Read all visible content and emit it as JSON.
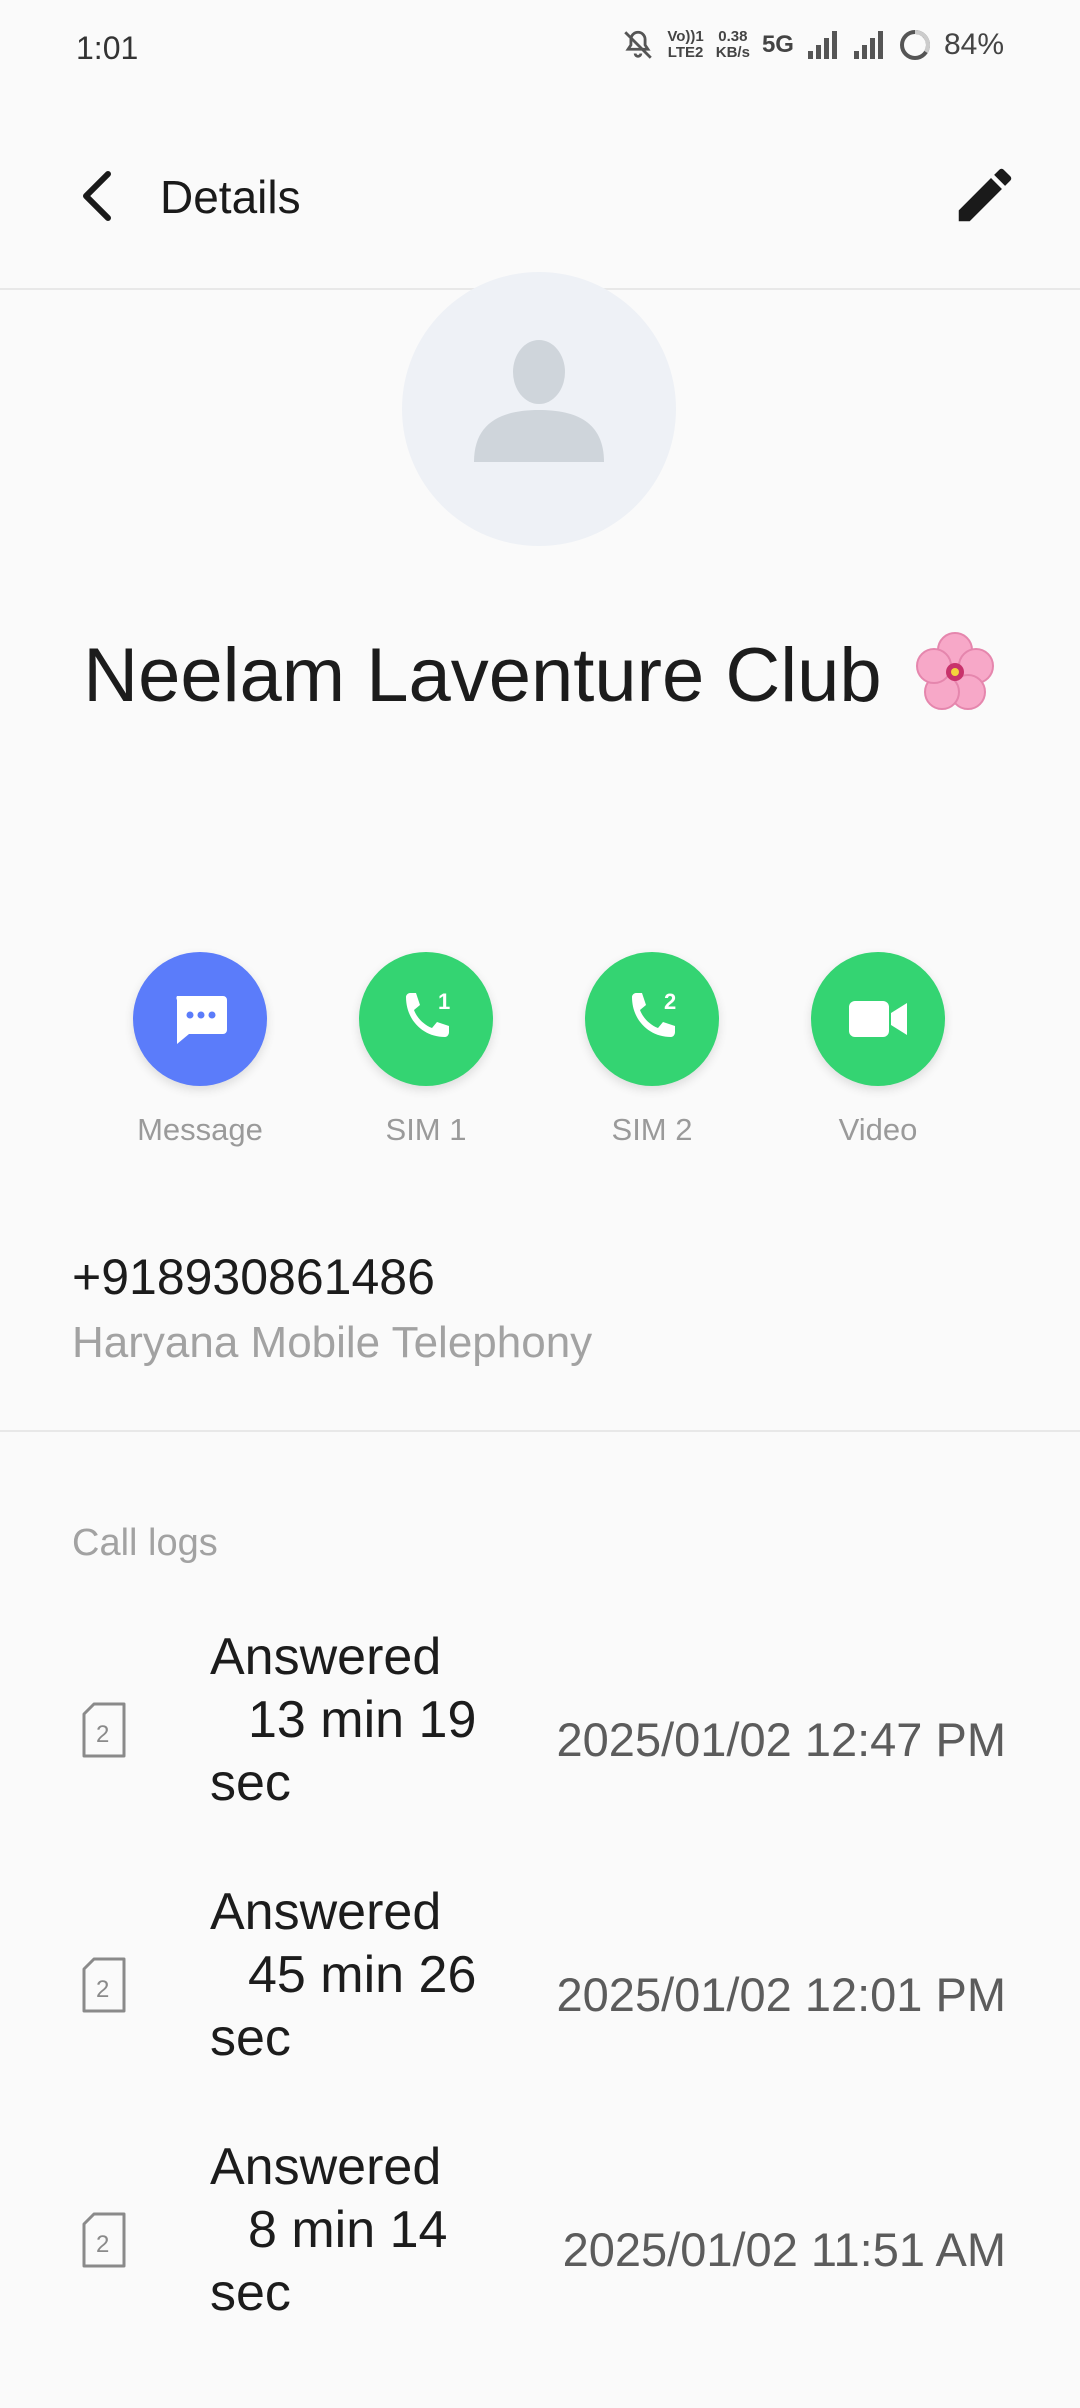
{
  "status_bar": {
    "time": "1:01",
    "volte_top": "Vo))1",
    "volte_bottom": "LTE2",
    "speed_value": "0.38",
    "speed_unit": "KB/s",
    "network": "5G",
    "battery": "84%",
    "icons": [
      "mute-icon",
      "volte-icon",
      "data-speed",
      "signal-icon",
      "signal-icon",
      "battery-ring-icon"
    ]
  },
  "app_bar": {
    "title": "Details",
    "back_icon": "chevron-left-icon",
    "edit_icon": "pencil-icon"
  },
  "contact": {
    "name": "Neelam Laventure Club",
    "avatar_icon": "person-icon",
    "emoji": "cherry-blossom"
  },
  "actions": [
    {
      "label": "Message",
      "icon": "message-icon",
      "color": "#5b7cfa"
    },
    {
      "label": "SIM 1",
      "icon": "phone-sim1-icon",
      "badge": "1",
      "color": "#34d472"
    },
    {
      "label": "SIM 2",
      "icon": "phone-sim2-icon",
      "badge": "2",
      "color": "#34d472"
    },
    {
      "label": "Video",
      "icon": "video-icon",
      "color": "#34d472"
    }
  ],
  "phone": {
    "number": "+918930861486",
    "carrier": "Haryana Mobile Telephony"
  },
  "call_logs": {
    "header": "Call logs",
    "entries": [
      {
        "sim": "2",
        "status": "Answered",
        "duration": "13 min 19",
        "unit": "sec",
        "datetime": "2025/01/02 12:47 PM"
      },
      {
        "sim": "2",
        "status": "Answered",
        "duration": "45 min 26",
        "unit": "sec",
        "datetime": "2025/01/02 12:01 PM"
      },
      {
        "sim": "2",
        "status": "Answered",
        "duration": "8 min 14",
        "unit": "sec",
        "datetime": "2025/01/02 11:51 AM"
      }
    ]
  }
}
